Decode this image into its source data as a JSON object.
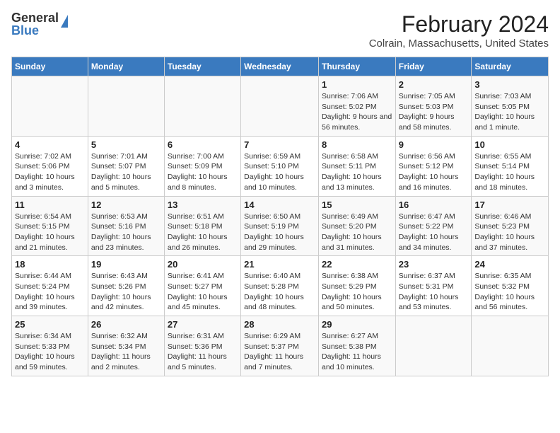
{
  "header": {
    "logo_general": "General",
    "logo_blue": "Blue",
    "title": "February 2024",
    "subtitle": "Colrain, Massachusetts, United States"
  },
  "days_of_week": [
    "Sunday",
    "Monday",
    "Tuesday",
    "Wednesday",
    "Thursday",
    "Friday",
    "Saturday"
  ],
  "weeks": [
    [
      {
        "day": "",
        "detail": ""
      },
      {
        "day": "",
        "detail": ""
      },
      {
        "day": "",
        "detail": ""
      },
      {
        "day": "",
        "detail": ""
      },
      {
        "day": "1",
        "detail": "Sunrise: 7:06 AM\nSunset: 5:02 PM\nDaylight: 9 hours and 56 minutes."
      },
      {
        "day": "2",
        "detail": "Sunrise: 7:05 AM\nSunset: 5:03 PM\nDaylight: 9 hours and 58 minutes."
      },
      {
        "day": "3",
        "detail": "Sunrise: 7:03 AM\nSunset: 5:05 PM\nDaylight: 10 hours and 1 minute."
      }
    ],
    [
      {
        "day": "4",
        "detail": "Sunrise: 7:02 AM\nSunset: 5:06 PM\nDaylight: 10 hours and 3 minutes."
      },
      {
        "day": "5",
        "detail": "Sunrise: 7:01 AM\nSunset: 5:07 PM\nDaylight: 10 hours and 5 minutes."
      },
      {
        "day": "6",
        "detail": "Sunrise: 7:00 AM\nSunset: 5:09 PM\nDaylight: 10 hours and 8 minutes."
      },
      {
        "day": "7",
        "detail": "Sunrise: 6:59 AM\nSunset: 5:10 PM\nDaylight: 10 hours and 10 minutes."
      },
      {
        "day": "8",
        "detail": "Sunrise: 6:58 AM\nSunset: 5:11 PM\nDaylight: 10 hours and 13 minutes."
      },
      {
        "day": "9",
        "detail": "Sunrise: 6:56 AM\nSunset: 5:12 PM\nDaylight: 10 hours and 16 minutes."
      },
      {
        "day": "10",
        "detail": "Sunrise: 6:55 AM\nSunset: 5:14 PM\nDaylight: 10 hours and 18 minutes."
      }
    ],
    [
      {
        "day": "11",
        "detail": "Sunrise: 6:54 AM\nSunset: 5:15 PM\nDaylight: 10 hours and 21 minutes."
      },
      {
        "day": "12",
        "detail": "Sunrise: 6:53 AM\nSunset: 5:16 PM\nDaylight: 10 hours and 23 minutes."
      },
      {
        "day": "13",
        "detail": "Sunrise: 6:51 AM\nSunset: 5:18 PM\nDaylight: 10 hours and 26 minutes."
      },
      {
        "day": "14",
        "detail": "Sunrise: 6:50 AM\nSunset: 5:19 PM\nDaylight: 10 hours and 29 minutes."
      },
      {
        "day": "15",
        "detail": "Sunrise: 6:49 AM\nSunset: 5:20 PM\nDaylight: 10 hours and 31 minutes."
      },
      {
        "day": "16",
        "detail": "Sunrise: 6:47 AM\nSunset: 5:22 PM\nDaylight: 10 hours and 34 minutes."
      },
      {
        "day": "17",
        "detail": "Sunrise: 6:46 AM\nSunset: 5:23 PM\nDaylight: 10 hours and 37 minutes."
      }
    ],
    [
      {
        "day": "18",
        "detail": "Sunrise: 6:44 AM\nSunset: 5:24 PM\nDaylight: 10 hours and 39 minutes."
      },
      {
        "day": "19",
        "detail": "Sunrise: 6:43 AM\nSunset: 5:26 PM\nDaylight: 10 hours and 42 minutes."
      },
      {
        "day": "20",
        "detail": "Sunrise: 6:41 AM\nSunset: 5:27 PM\nDaylight: 10 hours and 45 minutes."
      },
      {
        "day": "21",
        "detail": "Sunrise: 6:40 AM\nSunset: 5:28 PM\nDaylight: 10 hours and 48 minutes."
      },
      {
        "day": "22",
        "detail": "Sunrise: 6:38 AM\nSunset: 5:29 PM\nDaylight: 10 hours and 50 minutes."
      },
      {
        "day": "23",
        "detail": "Sunrise: 6:37 AM\nSunset: 5:31 PM\nDaylight: 10 hours and 53 minutes."
      },
      {
        "day": "24",
        "detail": "Sunrise: 6:35 AM\nSunset: 5:32 PM\nDaylight: 10 hours and 56 minutes."
      }
    ],
    [
      {
        "day": "25",
        "detail": "Sunrise: 6:34 AM\nSunset: 5:33 PM\nDaylight: 10 hours and 59 minutes."
      },
      {
        "day": "26",
        "detail": "Sunrise: 6:32 AM\nSunset: 5:34 PM\nDaylight: 11 hours and 2 minutes."
      },
      {
        "day": "27",
        "detail": "Sunrise: 6:31 AM\nSunset: 5:36 PM\nDaylight: 11 hours and 5 minutes."
      },
      {
        "day": "28",
        "detail": "Sunrise: 6:29 AM\nSunset: 5:37 PM\nDaylight: 11 hours and 7 minutes."
      },
      {
        "day": "29",
        "detail": "Sunrise: 6:27 AM\nSunset: 5:38 PM\nDaylight: 11 hours and 10 minutes."
      },
      {
        "day": "",
        "detail": ""
      },
      {
        "day": "",
        "detail": ""
      }
    ]
  ]
}
